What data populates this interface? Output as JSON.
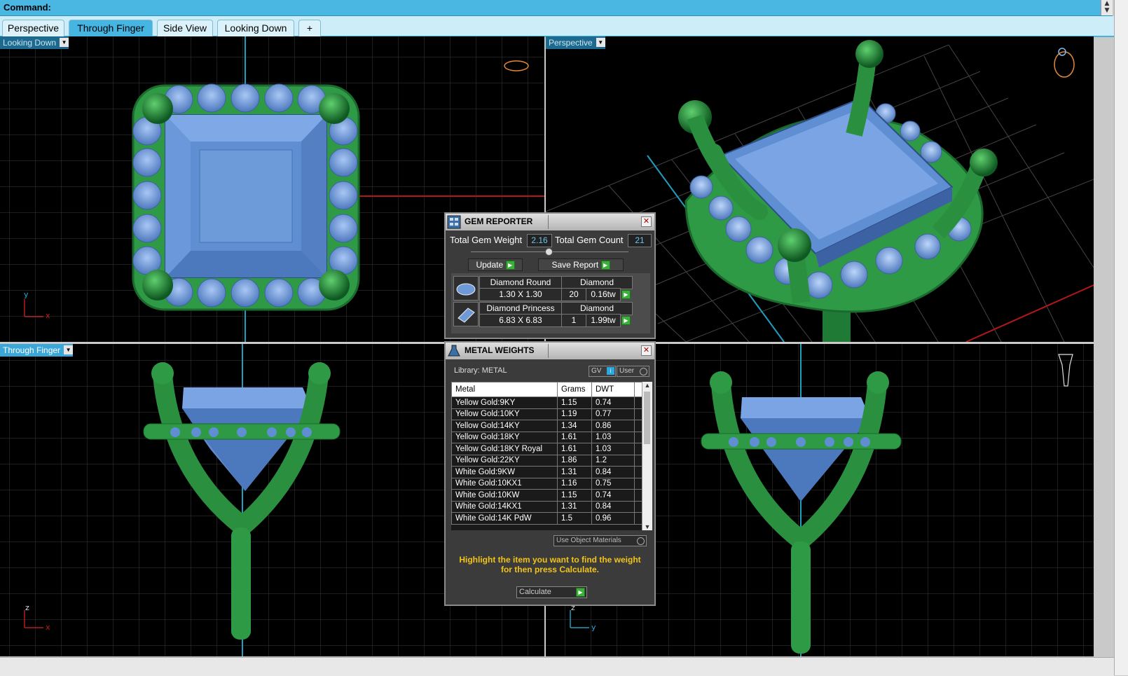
{
  "command_bar": {
    "label": "Command:"
  },
  "tabs": [
    {
      "label": "Perspective"
    },
    {
      "label": "Through Finger",
      "active": true
    },
    {
      "label": "Side View"
    },
    {
      "label": "Looking Down"
    },
    {
      "label": "+"
    }
  ],
  "viewports": {
    "top_left": {
      "label": "Looking Down",
      "axis1": "y",
      "axis2": "x"
    },
    "top_right": {
      "label": "Perspective"
    },
    "bottom_left": {
      "label": "Through Finger",
      "axis1": "z",
      "axis2": "x"
    },
    "bottom_right": {
      "axis1": "z",
      "axis2": "y"
    }
  },
  "gem_reporter": {
    "title": "GEM REPORTER",
    "total_weight_label": "Total Gem Weight",
    "total_weight_value": "2.16",
    "total_count_label": "Total Gem Count",
    "total_count_value": "21",
    "update_label": "Update",
    "save_report_label": "Save Report",
    "gems": [
      {
        "name": "Diamond Round",
        "material": "Diamond",
        "size": "1.30 X 1.30",
        "count": "20",
        "weight": "0.16tw"
      },
      {
        "name": "Diamond Princess",
        "material": "Diamond",
        "size": "6.83 X 6.83",
        "count": "1",
        "weight": "1.99tw"
      }
    ]
  },
  "metal_weights": {
    "title": "METAL WEIGHTS",
    "library_label": "Library: METAL",
    "gv_label": "GV",
    "user_label": "User",
    "columns": {
      "metal": "Metal",
      "grams": "Grams",
      "dwt": "DWT"
    },
    "rows": [
      {
        "metal": "Yellow Gold:9KY",
        "grams": "1.15",
        "dwt": "0.74"
      },
      {
        "metal": "Yellow Gold:10KY",
        "grams": "1.19",
        "dwt": "0.77"
      },
      {
        "metal": "Yellow Gold:14KY",
        "grams": "1.34",
        "dwt": "0.86"
      },
      {
        "metal": "Yellow Gold:18KY",
        "grams": "1.61",
        "dwt": "1.03"
      },
      {
        "metal": "Yellow Gold:18KY Royal",
        "grams": "1.61",
        "dwt": "1.03"
      },
      {
        "metal": "Yellow Gold:22KY",
        "grams": "1.86",
        "dwt": "1.2"
      },
      {
        "metal": "White Gold:9KW",
        "grams": "1.31",
        "dwt": "0.84"
      },
      {
        "metal": "White Gold:10KX1",
        "grams": "1.16",
        "dwt": "0.75"
      },
      {
        "metal": "White Gold:10KW",
        "grams": "1.15",
        "dwt": "0.74"
      },
      {
        "metal": "White Gold:14KX1",
        "grams": "1.31",
        "dwt": "0.84"
      },
      {
        "metal": "White Gold:14K PdW",
        "grams": "1.5",
        "dwt": "0.96"
      }
    ],
    "use_object_materials_label": "Use Object Materials",
    "hint": "Highlight the item you want to find the weight for then press Calculate.",
    "calculate_label": "Calculate"
  },
  "colors": {
    "accent": "#47b5e2",
    "viewport_bg": "#000000",
    "grid": "#3a3a3a",
    "metal_green": "#2f9d4a",
    "gem_blue": "#6e9ad8",
    "hint_text": "#f2c318"
  }
}
